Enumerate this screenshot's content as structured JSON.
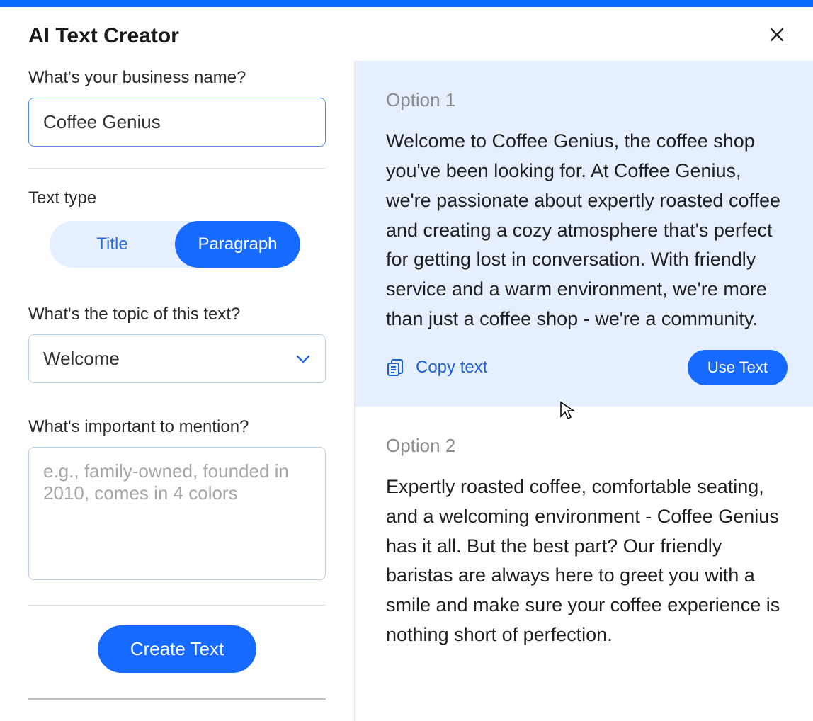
{
  "header": {
    "title": "AI Text Creator"
  },
  "form": {
    "business_label": "What's your business name?",
    "business_value": "Coffee Genius",
    "text_type_label": "Text type",
    "text_type_options": {
      "title": "Title",
      "paragraph": "Paragraph"
    },
    "topic_label": "What's the topic of this text?",
    "topic_value": "Welcome",
    "mention_label": "What's important to mention?",
    "mention_placeholder": "e.g., family-owned, founded in 2010, comes in 4 colors",
    "create_button": "Create Text"
  },
  "results": {
    "option1": {
      "label": "Option 1",
      "text": "Welcome to Coffee Genius, the coffee shop you've been looking for. At Coffee Genius, we're passionate about expertly roasted coffee and creating a cozy atmosphere that's perfect for getting lost in conversation. With friendly service and a warm environment, we're more than just a coffee shop - we're a community.",
      "copy_label": "Copy text",
      "use_label": "Use Text"
    },
    "option2": {
      "label": "Option 2",
      "text": "Expertly roasted coffee, comfortable seating, and a welcoming environment - Coffee Genius has it all. But the best part? Our friendly baristas are always here to greet you with a smile and make sure your coffee experience is nothing short of perfection."
    }
  }
}
